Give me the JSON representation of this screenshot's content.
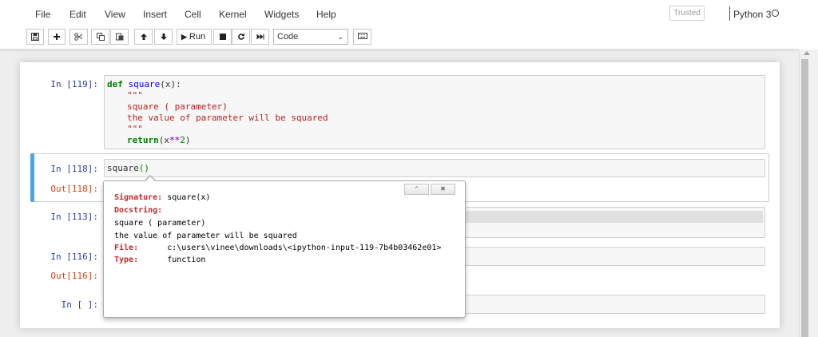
{
  "menu": [
    "File",
    "Edit",
    "View",
    "Insert",
    "Cell",
    "Kernel",
    "Widgets",
    "Help"
  ],
  "status": {
    "trusted": "Trusted",
    "kernel": "Python 3"
  },
  "toolbar": {
    "run_label": "Run",
    "cell_type": "Code"
  },
  "cells": {
    "c1": {
      "in_prompt": "In [119]:"
    },
    "c2": {
      "in_prompt": "In [118]:",
      "out_prompt": "Out[118]:",
      "code_name": "square",
      "code_open": "(",
      "code_close": ")"
    },
    "c3": {
      "in_prompt": "In [113]:"
    },
    "c4": {
      "in_prompt": "In [116]:",
      "out_prompt": "Out[116]:"
    },
    "c5": {
      "in_prompt": "In [ ]:"
    }
  },
  "code1": {
    "def": "def",
    "fname": "square",
    "args": "(x):",
    "doc_open": "\"\"\"",
    "doc_line1": "square ( parameter)",
    "doc_line2": "the value of parameter will be squared",
    "doc_close": "\"\"\"",
    "ret": "return",
    "ret_open": "(x",
    "ret_op": "**",
    "ret_num": "2",
    "ret_close": ")"
  },
  "tooltip": {
    "expand": "^",
    "close": "✖",
    "signature_label": "Signature:",
    "signature_value": " square(x)",
    "docstring_label": "Docstring:",
    "doc_line1": "square ( parameter)",
    "doc_line2": "the value of parameter will be squared",
    "file_label": "File:",
    "file_value": "      c:\\users\\vinee\\downloads\\<ipython-input-119-7b4b03462e01>",
    "type_label": "Type:",
    "type_value": "      function"
  }
}
